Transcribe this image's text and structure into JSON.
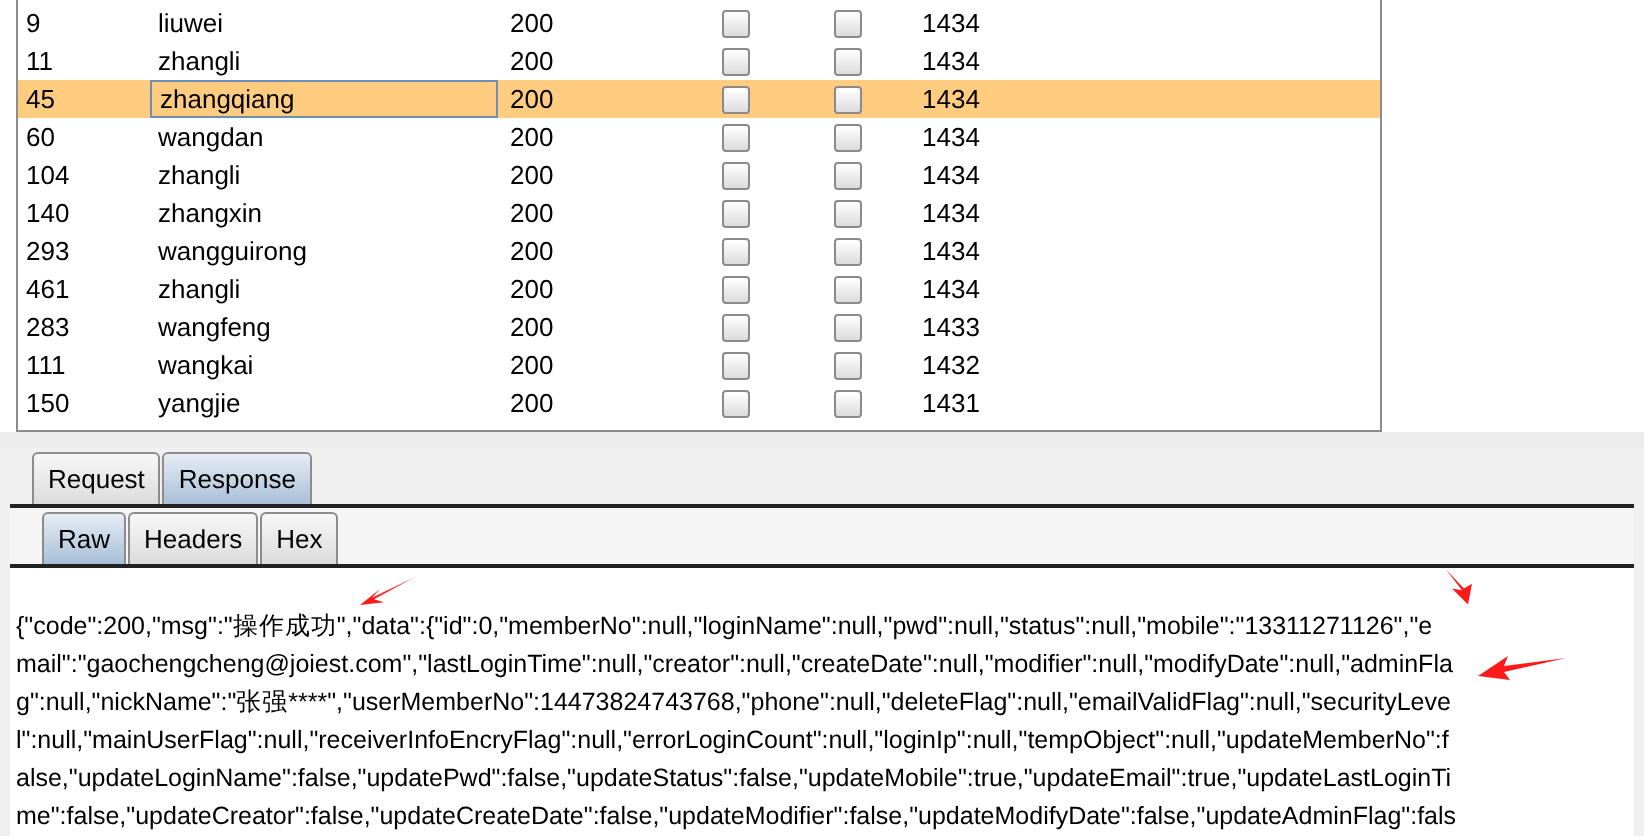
{
  "table": {
    "rows": [
      {
        "id": "9",
        "name": "liuwei",
        "status": "200",
        "column_4_checked": false,
        "column_5_checked": false,
        "length": "1434",
        "selected": false
      },
      {
        "id": "11",
        "name": "zhangli",
        "status": "200",
        "column_4_checked": false,
        "column_5_checked": false,
        "length": "1434",
        "selected": false
      },
      {
        "id": "45",
        "name": "zhangqiang",
        "status": "200",
        "column_4_checked": false,
        "column_5_checked": false,
        "length": "1434",
        "selected": true
      },
      {
        "id": "60",
        "name": "wangdan",
        "status": "200",
        "column_4_checked": false,
        "column_5_checked": false,
        "length": "1434",
        "selected": false
      },
      {
        "id": "104",
        "name": "zhangli",
        "status": "200",
        "column_4_checked": false,
        "column_5_checked": false,
        "length": "1434",
        "selected": false
      },
      {
        "id": "140",
        "name": "zhangxin",
        "status": "200",
        "column_4_checked": false,
        "column_5_checked": false,
        "length": "1434",
        "selected": false
      },
      {
        "id": "293",
        "name": "wangguirong",
        "status": "200",
        "column_4_checked": false,
        "column_5_checked": false,
        "length": "1434",
        "selected": false
      },
      {
        "id": "461",
        "name": "zhangli",
        "status": "200",
        "column_4_checked": false,
        "column_5_checked": false,
        "length": "1434",
        "selected": false
      },
      {
        "id": "283",
        "name": "wangfeng",
        "status": "200",
        "column_4_checked": false,
        "column_5_checked": false,
        "length": "1433",
        "selected": false
      },
      {
        "id": "111",
        "name": "wangkai",
        "status": "200",
        "column_4_checked": false,
        "column_5_checked": false,
        "length": "1432",
        "selected": false
      },
      {
        "id": "150",
        "name": "yangjie",
        "status": "200",
        "column_4_checked": false,
        "column_5_checked": false,
        "length": "1431",
        "selected": false
      }
    ]
  },
  "message_tabs": [
    {
      "label": "Request",
      "selected": false
    },
    {
      "label": "Response",
      "selected": true
    }
  ],
  "view_tabs": [
    {
      "label": "Raw",
      "selected": true
    },
    {
      "label": "Headers",
      "selected": false
    },
    {
      "label": "Hex",
      "selected": false
    }
  ],
  "body_lines": [
    "{\"code\":200,\"msg\":\"操作成功\",\"data\":{\"id\":0,\"memberNo\":null,\"loginName\":null,\"pwd\":null,\"status\":null,\"mobile\":\"13311271126\",\"e",
    "mail\":\"gaochengcheng@joiest.com\",\"lastLoginTime\":null,\"creator\":null,\"createDate\":null,\"modifier\":null,\"modifyDate\":null,\"adminFla",
    "g\":null,\"nickName\":\"张强****\",\"userMemberNo\":14473824743768,\"phone\":null,\"deleteFlag\":null,\"emailValidFlag\":null,\"securityLeve",
    "l\":null,\"mainUserFlag\":null,\"receiverInfoEncryFlag\":null,\"errorLoginCount\":null,\"loginIp\":null,\"tempObject\":null,\"updateMemberNo\":f",
    "alse,\"updateLoginName\":false,\"updatePwd\":false,\"updateStatus\":false,\"updateMobile\":true,\"updateEmail\":true,\"updateLastLoginTi",
    "me\":false,\"updateCreator\":false,\"updateCreateDate\":false,\"updateModifier\":false,\"updateModifyDate\":false,\"updateAdminFlag\":fals"
  ]
}
